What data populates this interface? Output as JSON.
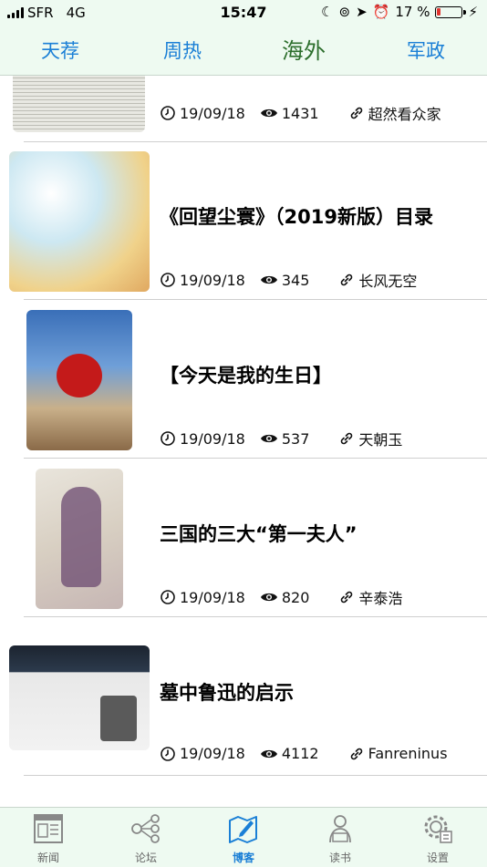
{
  "status_bar": {
    "carrier": "SFR",
    "network": "4G",
    "time": "15:47",
    "battery_percent": "17 %",
    "battery_level": 0.17
  },
  "top_tabs": [
    {
      "label": "天荐",
      "active": false
    },
    {
      "label": "周热",
      "active": false
    },
    {
      "label": "海外",
      "active": true
    },
    {
      "label": "军政",
      "active": false
    }
  ],
  "posts": [
    {
      "title": "",
      "date": "19/09/18",
      "views": "1431",
      "author": "超然看众家"
    },
    {
      "title": "《回望尘寰》（2019新版）目录",
      "date": "19/09/18",
      "views": "345",
      "author": "长风无空"
    },
    {
      "title": "【今天是我的生日】",
      "date": "19/09/18",
      "views": "537",
      "author": "天朝玉"
    },
    {
      "title": "三国的三大“第一夫人”",
      "date": "19/09/18",
      "views": "820",
      "author": "辛泰浩"
    },
    {
      "title": "墓中鲁迅的启示",
      "date": "19/09/18",
      "views": "4112",
      "author": "Fanreninus"
    }
  ],
  "bottom_tabs": [
    {
      "label": "新闻",
      "icon": "newspaper-icon",
      "active": false
    },
    {
      "label": "论坛",
      "icon": "forum-network-icon",
      "active": false
    },
    {
      "label": "博客",
      "icon": "blog-map-pen-icon",
      "active": true
    },
    {
      "label": "读书",
      "icon": "reader-person-icon",
      "active": false
    },
    {
      "label": "设置",
      "icon": "settings-gear-icon",
      "active": false
    }
  ],
  "colors": {
    "accent": "#1a7fd6",
    "active_tab": "#2c6e2c",
    "header_bg": "#eefaf1",
    "battery_low": "#e0332e"
  }
}
